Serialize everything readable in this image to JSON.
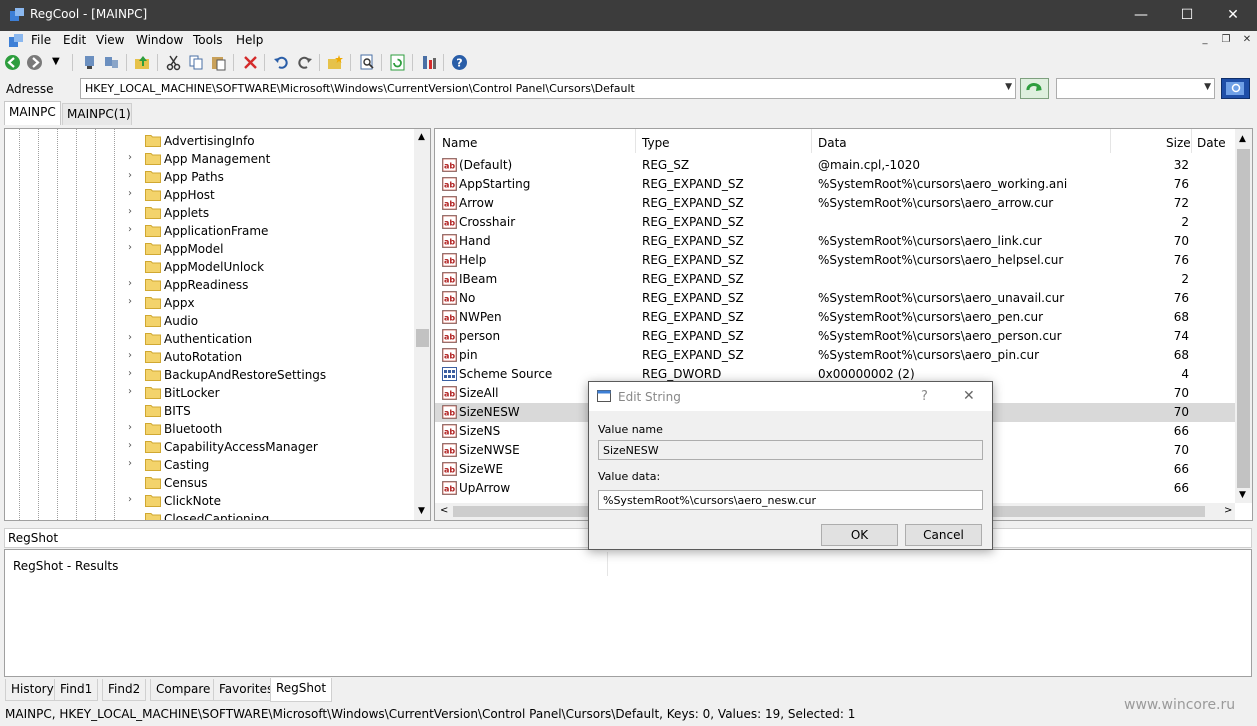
{
  "window": {
    "title": "RegCool - [MAINPC]",
    "minimize": "—",
    "maximize": "☐",
    "close": "✕"
  },
  "menu": [
    "File",
    "Edit",
    "View",
    "Window",
    "Tools",
    "Help"
  ],
  "address": {
    "label": "Adresse",
    "path": "HKEY_LOCAL_MACHINE\\SOFTWARE\\Microsoft\\Windows\\CurrentVersion\\Control Panel\\Cursors\\Default",
    "search_value": ""
  },
  "top_tabs": [
    "MAINPC",
    "MAINPC(1)"
  ],
  "tree": {
    "items": [
      {
        "label": "AdvertisingInfo",
        "expandable": false
      },
      {
        "label": "App Management",
        "expandable": true
      },
      {
        "label": "App Paths",
        "expandable": true
      },
      {
        "label": "AppHost",
        "expandable": true
      },
      {
        "label": "Applets",
        "expandable": true
      },
      {
        "label": "ApplicationFrame",
        "expandable": true
      },
      {
        "label": "AppModel",
        "expandable": true
      },
      {
        "label": "AppModelUnlock",
        "expandable": false
      },
      {
        "label": "AppReadiness",
        "expandable": true
      },
      {
        "label": "Appx",
        "expandable": true
      },
      {
        "label": "Audio",
        "expandable": false
      },
      {
        "label": "Authentication",
        "expandable": true
      },
      {
        "label": "AutoRotation",
        "expandable": true
      },
      {
        "label": "BackupAndRestoreSettings",
        "expandable": true
      },
      {
        "label": "BitLocker",
        "expandable": true
      },
      {
        "label": "BITS",
        "expandable": false
      },
      {
        "label": "Bluetooth",
        "expandable": true
      },
      {
        "label": "CapabilityAccessManager",
        "expandable": true
      },
      {
        "label": "Casting",
        "expandable": true
      },
      {
        "label": "Census",
        "expandable": false
      },
      {
        "label": "ClickNote",
        "expandable": true
      },
      {
        "label": "ClosedCaptioning",
        "expandable": false
      }
    ]
  },
  "list": {
    "columns": {
      "name": "Name",
      "type": "Type",
      "data": "Data",
      "size": "Size",
      "date": "Date"
    },
    "rows": [
      {
        "name": "(Default)",
        "type": "REG_SZ",
        "data": "@main.cpl,-1020",
        "size": "32",
        "icon": "string-icon"
      },
      {
        "name": "AppStarting",
        "type": "REG_EXPAND_SZ",
        "data": "%SystemRoot%\\cursors\\aero_working.ani",
        "size": "76",
        "icon": "string-icon"
      },
      {
        "name": "Arrow",
        "type": "REG_EXPAND_SZ",
        "data": "%SystemRoot%\\cursors\\aero_arrow.cur",
        "size": "72",
        "icon": "string-icon"
      },
      {
        "name": "Crosshair",
        "type": "REG_EXPAND_SZ",
        "data": "",
        "size": "2",
        "icon": "string-icon"
      },
      {
        "name": "Hand",
        "type": "REG_EXPAND_SZ",
        "data": "%SystemRoot%\\cursors\\aero_link.cur",
        "size": "70",
        "icon": "string-icon"
      },
      {
        "name": "Help",
        "type": "REG_EXPAND_SZ",
        "data": "%SystemRoot%\\cursors\\aero_helpsel.cur",
        "size": "76",
        "icon": "string-icon"
      },
      {
        "name": "IBeam",
        "type": "REG_EXPAND_SZ",
        "data": "",
        "size": "2",
        "icon": "string-icon"
      },
      {
        "name": "No",
        "type": "REG_EXPAND_SZ",
        "data": "%SystemRoot%\\cursors\\aero_unavail.cur",
        "size": "76",
        "icon": "string-icon"
      },
      {
        "name": "NWPen",
        "type": "REG_EXPAND_SZ",
        "data": "%SystemRoot%\\cursors\\aero_pen.cur",
        "size": "68",
        "icon": "string-icon"
      },
      {
        "name": "person",
        "type": "REG_EXPAND_SZ",
        "data": "%SystemRoot%\\cursors\\aero_person.cur",
        "size": "74",
        "icon": "string-icon"
      },
      {
        "name": "pin",
        "type": "REG_EXPAND_SZ",
        "data": "%SystemRoot%\\cursors\\aero_pin.cur",
        "size": "68",
        "icon": "string-icon"
      },
      {
        "name": "Scheme Source",
        "type": "REG_DWORD",
        "data": "0x00000002 (2)",
        "size": "4",
        "icon": "dword-icon"
      },
      {
        "name": "SizeAll",
        "type": "",
        "data": "ve.cur",
        "size": "70",
        "icon": "string-icon"
      },
      {
        "name": "SizeNESW",
        "type": "",
        "data": "w.cur",
        "size": "70",
        "icon": "string-icon",
        "selected": true
      },
      {
        "name": "SizeNS",
        "type": "",
        "data": "cur",
        "size": "66",
        "icon": "string-icon"
      },
      {
        "name": "SizeNWSE",
        "type": "",
        "data": "se.cur",
        "size": "70",
        "icon": "string-icon"
      },
      {
        "name": "SizeWE",
        "type": "",
        "data": "cur",
        "size": "66",
        "icon": "string-icon"
      },
      {
        "name": "UpArrow",
        "type": "",
        "data": "cur",
        "size": "66",
        "icon": "string-icon"
      }
    ]
  },
  "regshot": {
    "label": "RegShot",
    "results": "RegShot - Results"
  },
  "bottom_tabs": [
    "History",
    "Find1",
    "Find2",
    "Compare",
    "Favorites",
    "RegShot"
  ],
  "status": "MAINPC, HKEY_LOCAL_MACHINE\\SOFTWARE\\Microsoft\\Windows\\CurrentVersion\\Control Panel\\Cursors\\Default, Keys: 0, Values: 19, Selected: 1",
  "watermark": "www.wincore.ru",
  "dialog": {
    "title": "Edit String",
    "help": "?",
    "close": "✕",
    "value_name_label": "Value name",
    "value_name": "SizeNESW",
    "value_data_label": "Value data:",
    "value_data": "%SystemRoot%\\cursors\\aero_nesw.cur",
    "ok": "OK",
    "cancel": "Cancel"
  },
  "colors": {
    "titlebar": "#3c3c3c",
    "selection": "#d9d9d9",
    "folder": "#f3d36b"
  }
}
